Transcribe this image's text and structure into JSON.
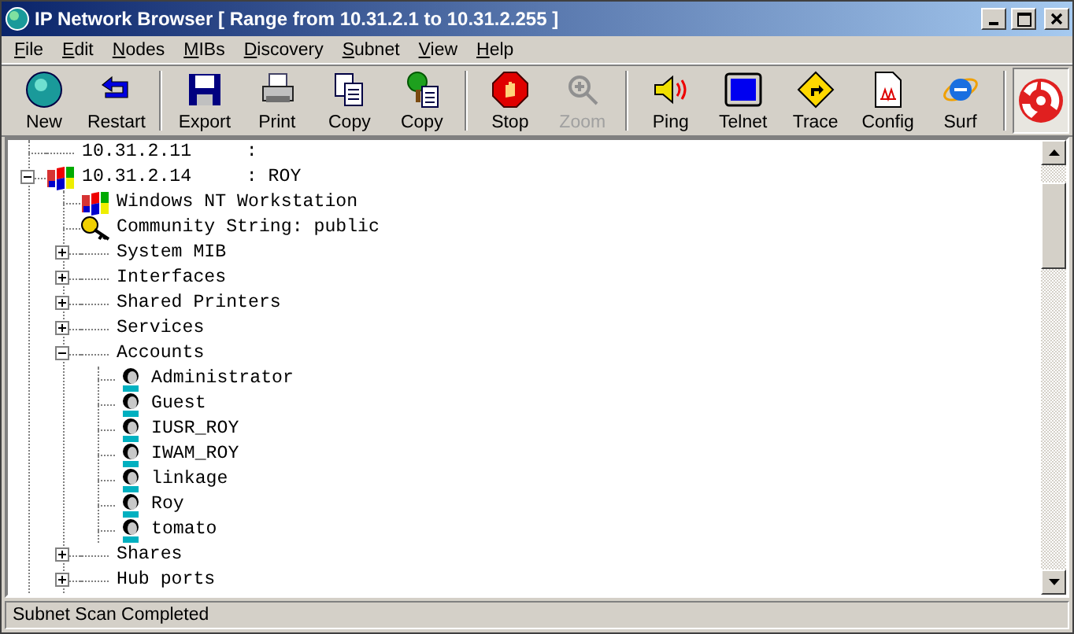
{
  "window": {
    "title": "IP Network Browser [ Range from 10.31.2.1 to 10.31.2.255 ]"
  },
  "menu": [
    "File",
    "Edit",
    "Nodes",
    "MIBs",
    "Discovery",
    "Subnet",
    "View",
    "Help"
  ],
  "toolbar": [
    {
      "buttons": [
        {
          "label": "New",
          "kind": "new",
          "disabled": false
        },
        {
          "label": "Restart",
          "kind": "restart",
          "disabled": false
        }
      ]
    },
    {
      "buttons": [
        {
          "label": "Export",
          "kind": "export",
          "disabled": false
        },
        {
          "label": "Print",
          "kind": "print",
          "disabled": false
        },
        {
          "label": "Copy",
          "kind": "copy",
          "disabled": false
        },
        {
          "label": "Copy",
          "kind": "copytree",
          "disabled": false
        }
      ]
    },
    {
      "buttons": [
        {
          "label": "Stop",
          "kind": "stop",
          "disabled": false
        },
        {
          "label": "Zoom",
          "kind": "zoom",
          "disabled": true
        }
      ]
    },
    {
      "buttons": [
        {
          "label": "Ping",
          "kind": "ping",
          "disabled": false
        },
        {
          "label": "Telnet",
          "kind": "telnet",
          "disabled": false
        },
        {
          "label": "Trace",
          "kind": "trace",
          "disabled": false
        },
        {
          "label": "Config",
          "kind": "config",
          "disabled": false
        },
        {
          "label": "Surf",
          "kind": "surf",
          "disabled": false
        }
      ]
    }
  ],
  "tree": [
    {
      "label": "10.31.2.11     :",
      "kind": "none"
    },
    {
      "label": "10.31.2.14     : ROY",
      "kind": "host",
      "expanded": true,
      "children": [
        {
          "label": "Windows NT Workstation",
          "kind": "os"
        },
        {
          "label": "Community String: public",
          "kind": "key"
        },
        {
          "label": "System MIB",
          "kind": "none",
          "expanded": false
        },
        {
          "label": "Interfaces",
          "kind": "none",
          "expanded": false
        },
        {
          "label": "Shared Printers",
          "kind": "none",
          "expanded": false
        },
        {
          "label": "Services",
          "kind": "none",
          "expanded": false
        },
        {
          "label": "Accounts",
          "kind": "none",
          "expanded": true,
          "children": [
            {
              "label": "Administrator",
              "kind": "user"
            },
            {
              "label": "Guest",
              "kind": "user"
            },
            {
              "label": "IUSR_ROY",
              "kind": "user"
            },
            {
              "label": "IWAM_ROY",
              "kind": "user"
            },
            {
              "label": "linkage",
              "kind": "user"
            },
            {
              "label": "Roy",
              "kind": "user"
            },
            {
              "label": "tomato",
              "kind": "user"
            }
          ]
        },
        {
          "label": "Shares",
          "kind": "none",
          "expanded": false
        },
        {
          "label": "Hub ports",
          "kind": "none",
          "expanded": false
        }
      ]
    }
  ],
  "status_bar": "Subnet Scan Completed"
}
